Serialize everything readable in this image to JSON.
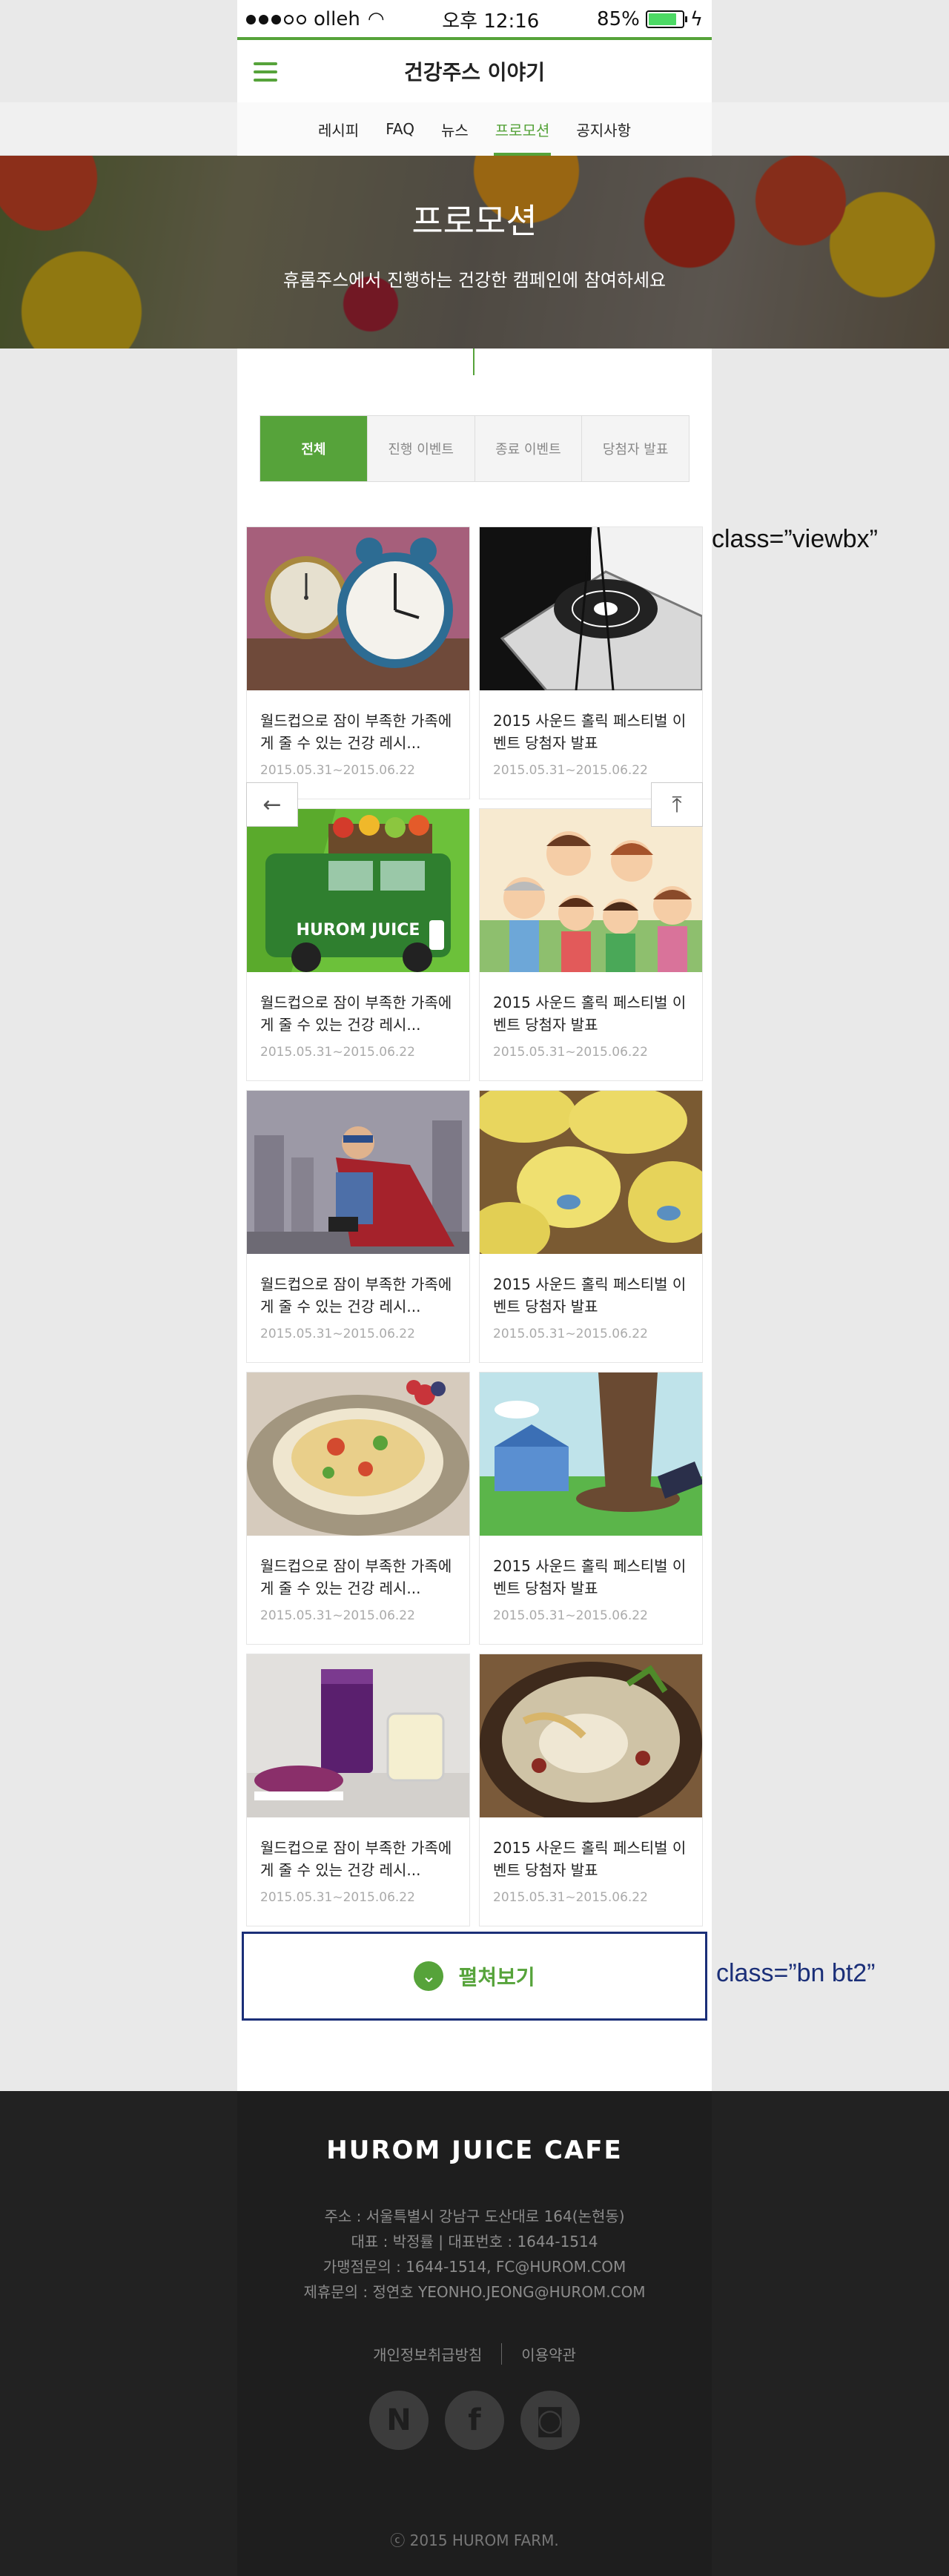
{
  "status_bar": {
    "carrier": "olleh",
    "time": "오후 12:16",
    "battery": "85%",
    "battery_level": 0.85
  },
  "header": {
    "title": "건강주스 이야기"
  },
  "subnav": {
    "items": [
      "레시피",
      "FAQ",
      "뉴스",
      "프로모션",
      "공지사항"
    ],
    "active": "프로모션"
  },
  "hero": {
    "title": "프로모션",
    "subtitle": "휴롬주스에서 진행하는 건강한 캠페인에 참여하세요"
  },
  "tabs": [
    "전체",
    "진행 이벤트",
    "종료 이벤트",
    "당첨자 발표"
  ],
  "cards": [
    {
      "title": "월드컵으로 잠이 부족한 가족에게 줄 수 있는 건강 레시...",
      "date": "2015.05.31~2015.06.22",
      "thumb": "alarm-clocks"
    },
    {
      "title": "2015 사운드 홀릭 페스티벌 이벤트 당첨자 발표",
      "date": "2015.05.31~2015.06.22",
      "thumb": "turntable"
    },
    {
      "title": "월드컵으로 잠이 부족한 가족에게 줄 수 있는 건강 레시...",
      "date": "2015.05.31~2015.06.22",
      "thumb": "hurom-juice-truck"
    },
    {
      "title": "2015 사운드 홀릭 페스티벌 이벤트 당첨자 발표",
      "date": "2015.05.31~2015.06.22",
      "thumb": "family-cartoon"
    },
    {
      "title": "월드컵으로 잠이 부족한 가족에게 줄 수 있는 건강 레시...",
      "date": "2015.05.31~2015.06.22",
      "thumb": "caped-child"
    },
    {
      "title": "2015 사운드 홀릭 페스티벌 이벤트 당첨자 발표",
      "date": "2015.05.31~2015.06.22",
      "thumb": "melons"
    },
    {
      "title": "월드컵으로 잠이 부족한 가족에게 줄 수 있는 건강 레시...",
      "date": "2015.05.31~2015.06.22",
      "thumb": "salad-plate"
    },
    {
      "title": "2015 사운드 홀릭 페스티벌 이벤트 당첨자 발표",
      "date": "2015.05.31~2015.06.22",
      "thumb": "tree-illustration"
    },
    {
      "title": "월드컵으로 잠이 부족한 가족에게 줄 수 있는 건강 레시...",
      "date": "2015.05.31~2015.06.22",
      "thumb": "purple-juice"
    },
    {
      "title": "2015 사운드 홀릭 페스티벌 이벤트 당첨자 발표",
      "date": "2015.05.31~2015.06.22",
      "thumb": "ginseng-soup"
    }
  ],
  "more_button": {
    "label": "펼쳐보기"
  },
  "annotations": {
    "viewbx": "class=”viewbx”",
    "bn_bt2": "class=”bn bt2”"
  },
  "footer": {
    "logo": "HUROM JUICE CAFE",
    "address": "주소 : 서울특별시 강남구 도산대로 164(논현동)",
    "ceo": "대표 : 박정률 | 대표번호 : 1644-1514",
    "franchise": "가맹점문의 : 1644-1514, FC@HUROM.COM",
    "partnership": "제휴문의 : 정연호 YEONHO.JEONG@HUROM.COM",
    "links": [
      "개인정보취급방침",
      "이용약관"
    ],
    "social": [
      "N",
      "f",
      "◙"
    ],
    "copyright": "ⓒ 2015 HUROM FARM."
  },
  "colors": {
    "accent": "#56a33a",
    "annotation_blue": "#1b2f78",
    "footer_bg": "#1e1e1e"
  }
}
